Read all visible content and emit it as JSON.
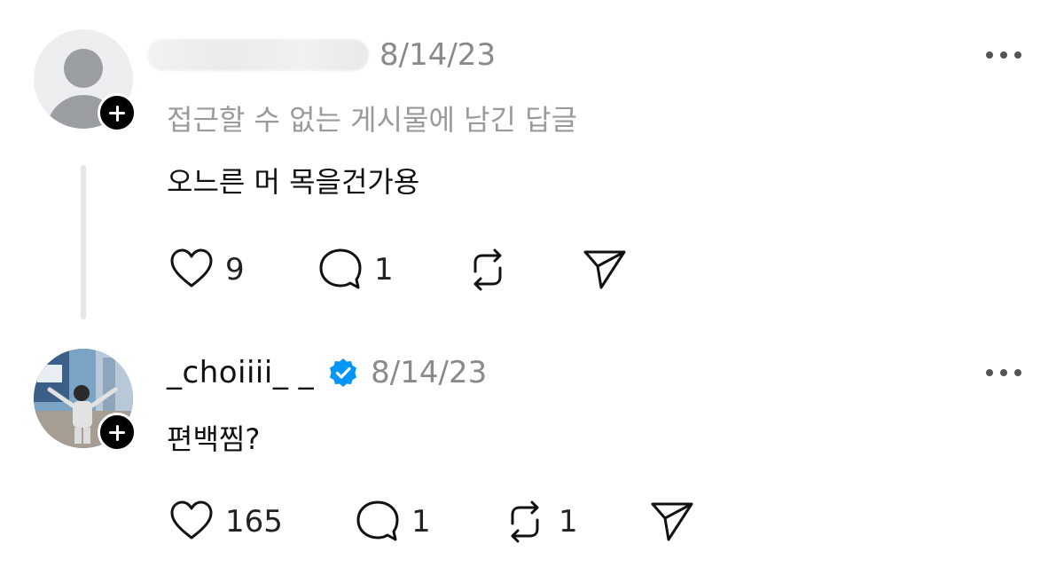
{
  "posts": [
    {
      "username": "",
      "timestamp": "8/14/23",
      "context": "접근할 수 없는 게시물에 남긴 답글",
      "text": "오느른 머 목을건가용",
      "likes": "9",
      "replies": "1",
      "reposts": ""
    },
    {
      "username": "_choiiii_ _",
      "verified": true,
      "timestamp": "8/14/23",
      "text": "편백찜?",
      "likes": "165",
      "replies": "1",
      "reposts": "1"
    }
  ],
  "icons": {
    "like": "heart-icon",
    "reply": "comment-icon",
    "repost": "repost-icon",
    "share": "send-icon",
    "more": "more-dots-icon",
    "follow": "plus-icon",
    "verified": "verified-badge-icon"
  },
  "colors": {
    "verified": "#0095f6",
    "muted_text": "#9a9a9a",
    "text": "#111111",
    "thread_line": "#e6e6e6"
  }
}
